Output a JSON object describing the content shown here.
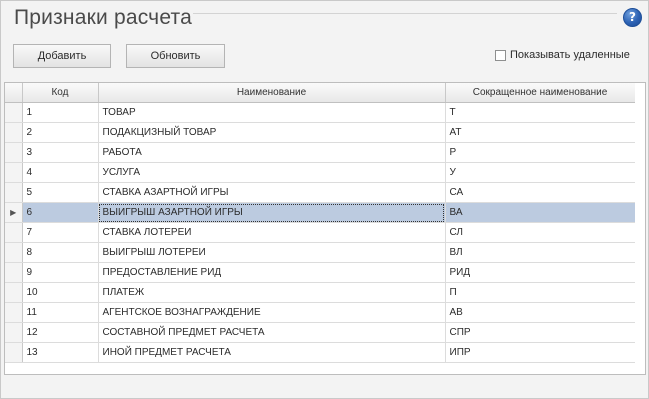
{
  "window": {
    "title": "Признаки расчета",
    "help_glyph": "?"
  },
  "toolbar": {
    "add_label": "Добавить",
    "refresh_label": "Обновить",
    "show_deleted_label": "Показывать удаленные",
    "show_deleted_checked": false
  },
  "table": {
    "columns": [
      "Код",
      "Наименование",
      "Сокращенное наименование"
    ],
    "selected_row_index": 5,
    "row_indicator_glyph": "▶",
    "rows": [
      {
        "code": "1",
        "name": "ТОВАР",
        "short": "Т"
      },
      {
        "code": "2",
        "name": "ПОДАКЦИЗНЫЙ ТОВАР",
        "short": "АТ"
      },
      {
        "code": "3",
        "name": "РАБОТА",
        "short": "Р"
      },
      {
        "code": "4",
        "name": "УСЛУГА",
        "short": "У"
      },
      {
        "code": "5",
        "name": "СТАВКА АЗАРТНОЙ ИГРЫ",
        "short": "СА"
      },
      {
        "code": "6",
        "name": "ВЫИГРЫШ АЗАРТНОЙ ИГРЫ",
        "short": "ВА"
      },
      {
        "code": "7",
        "name": "СТАВКА ЛОТЕРЕИ",
        "short": "СЛ"
      },
      {
        "code": "8",
        "name": "ВЫИГРЫШ ЛОТЕРЕИ",
        "short": "ВЛ"
      },
      {
        "code": "9",
        "name": "ПРЕДОСТАВЛЕНИЕ РИД",
        "short": "РИД"
      },
      {
        "code": "10",
        "name": "ПЛАТЕЖ",
        "short": "П"
      },
      {
        "code": "11",
        "name": "АГЕНТСКОЕ ВОЗНАГРАЖДЕНИЕ",
        "short": "АВ"
      },
      {
        "code": "12",
        "name": "СОСТАВНОЙ ПРЕДМЕТ РАСЧЕТА",
        "short": "СПР"
      },
      {
        "code": "13",
        "name": "ИНОЙ ПРЕДМЕТ РАСЧЕТА",
        "short": "ИПР"
      }
    ]
  },
  "colors": {
    "selected_row": "#bccbe0",
    "help_icon": "#2c62b4"
  }
}
